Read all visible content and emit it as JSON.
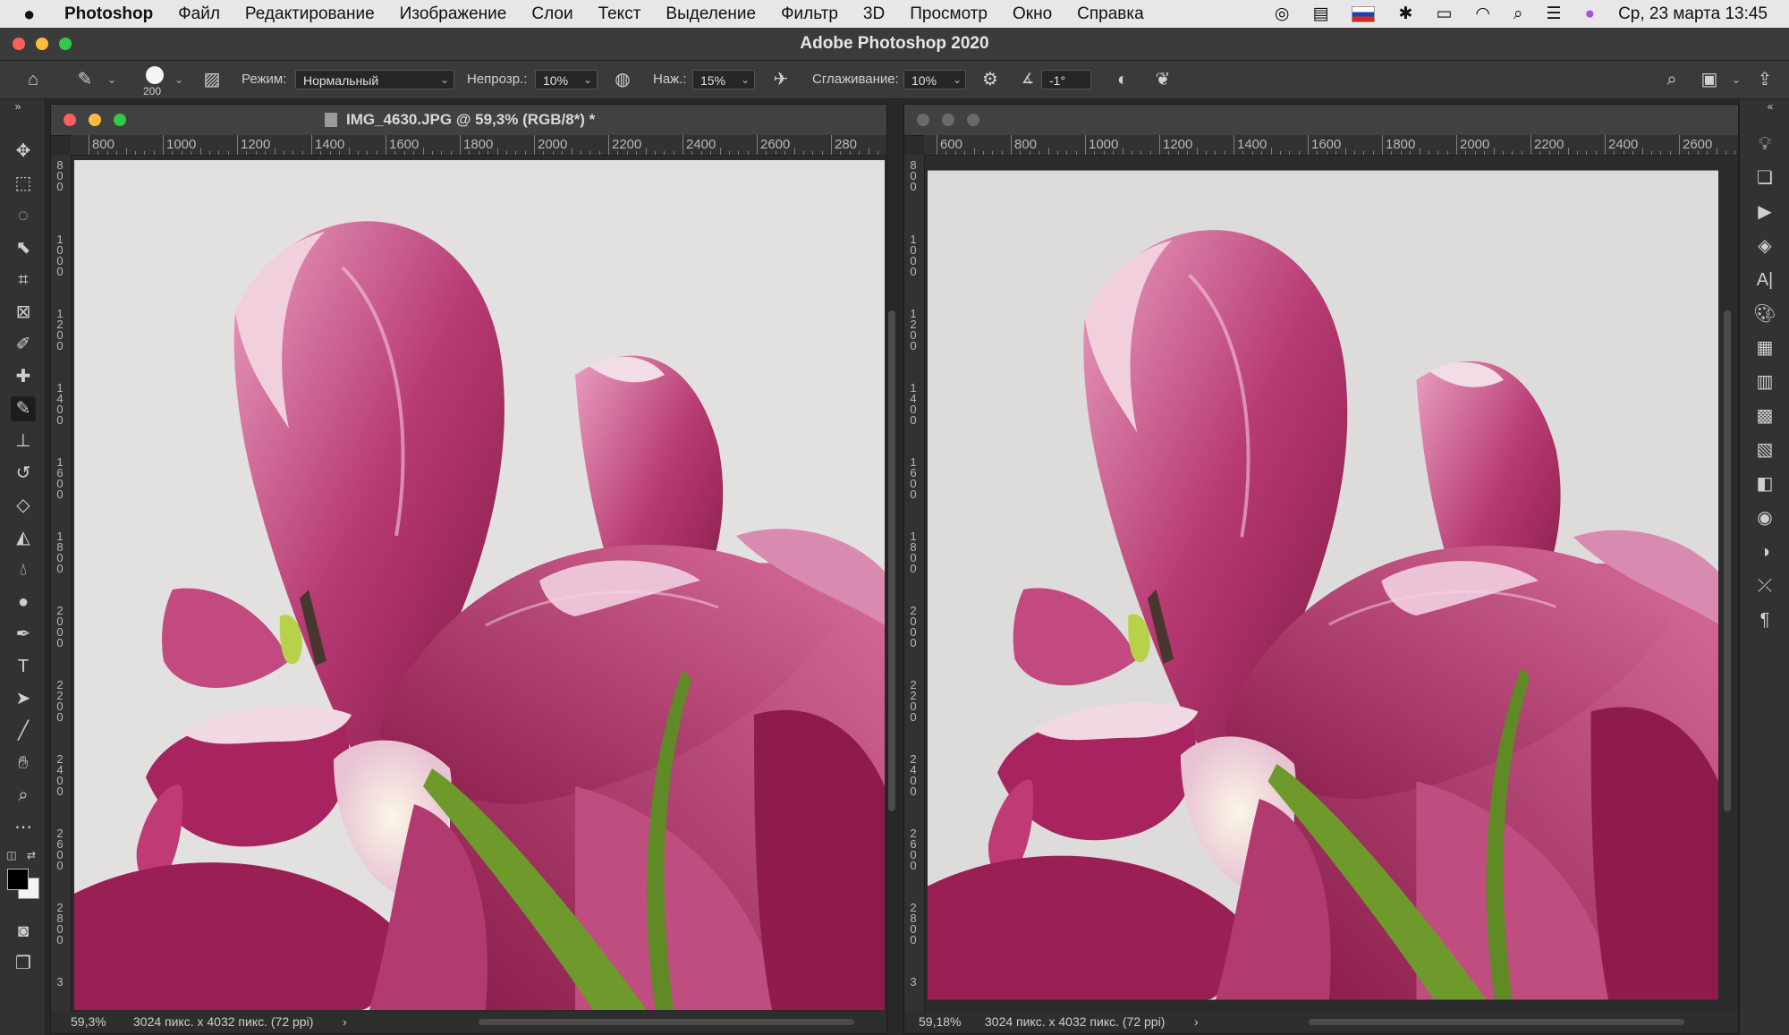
{
  "menubar": {
    "items": [
      "Photoshop",
      "Файл",
      "Редактирование",
      "Изображение",
      "Слои",
      "Текст",
      "Выделение",
      "Фильтр",
      "3D",
      "Просмотр",
      "Окно",
      "Справка"
    ],
    "datetime": "Ср, 23 марта  13:45"
  },
  "window": {
    "title": "Adobe Photoshop 2020"
  },
  "options": {
    "brush_size": "200",
    "mode_label": "Режим:",
    "mode_value": "Нормальный",
    "opacity_label": "Непрозр.:",
    "opacity_value": "10%",
    "pressure_label": "Наж.:",
    "pressure_value": "15%",
    "smoothing_label": "Сглаживание:",
    "smoothing_value": "10%",
    "angle_value": "-1°"
  },
  "doc_left": {
    "tab_title": "IMG_4630.JPG @ 59,3% (RGB/8*) *",
    "ruler_labels": [
      "800",
      "1000",
      "1200",
      "1400",
      "1600",
      "1800",
      "2000",
      "2200",
      "2400",
      "2600",
      "280"
    ],
    "vruler_labels": [
      "800",
      "1000",
      "1200",
      "1400",
      "1600",
      "1800",
      "2000",
      "2200",
      "2400",
      "2600",
      "2800",
      "3"
    ],
    "zoom": "59,3%",
    "info": "3024 пикс. x 4032 пикс. (72 ppi)"
  },
  "doc_right": {
    "ruler_labels": [
      "600",
      "800",
      "1000",
      "1200",
      "1400",
      "1600",
      "1800",
      "2000",
      "2200",
      "2400",
      "2600"
    ],
    "vruler_labels": [
      "800",
      "1000",
      "1200",
      "1400",
      "1600",
      "1800",
      "2000",
      "2200",
      "2400",
      "2600",
      "2800",
      "3"
    ],
    "zoom": "59,18%",
    "info": "3024 пикс. x 4032 пикс. (72 ppi)"
  },
  "colors": {
    "petal_dark": "#8e1a4c",
    "petal_mid": "#c0437a",
    "petal_light": "#e7a9c4",
    "stem": "#6e9a2c",
    "wall": "#e3e1e0"
  }
}
